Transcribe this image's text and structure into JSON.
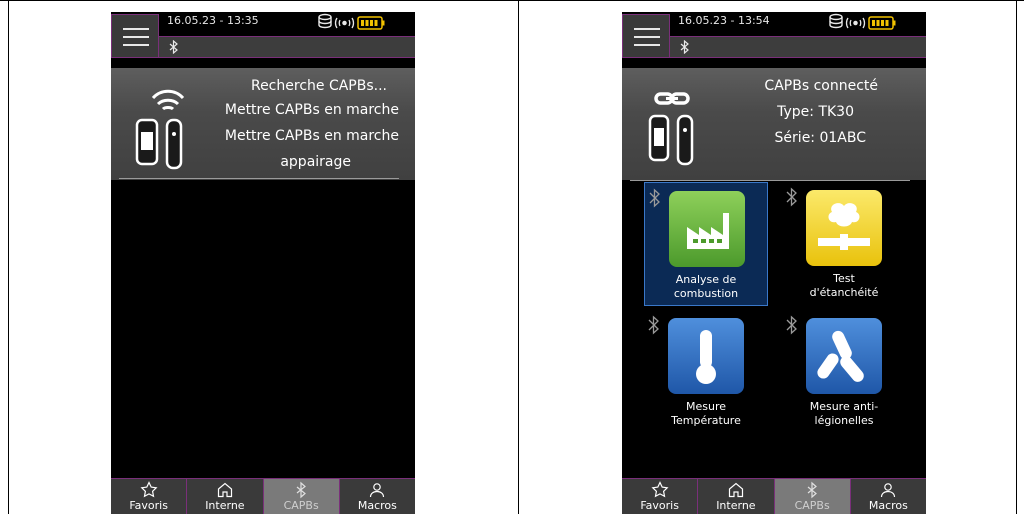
{
  "left_screen": {
    "datetime": "16.05.23 - 13:35",
    "info_lines": [
      "Recherche CAPBs...",
      "Mettre CAPBs en marche",
      "Mettre CAPBs en marche",
      "appairage"
    ]
  },
  "right_screen": {
    "datetime": "16.05.23 - 13:54",
    "info_lines": [
      "CAPBs connecté",
      "Type: TK30",
      "Série: 01ABC"
    ],
    "tiles": [
      {
        "line1": "Analyse de",
        "line2": "combustion"
      },
      {
        "line1": "Test",
        "line2": "d'étanchéité"
      },
      {
        "line1": "Mesure",
        "line2": "Température"
      },
      {
        "line1": "Mesure anti-",
        "line2": "légionelles"
      }
    ]
  },
  "nav": {
    "items": [
      "Favoris",
      "Interne",
      "CAPBs",
      "Macros"
    ],
    "active": "CAPBs"
  },
  "colors": {
    "accent_border": "#7a2f7a",
    "tile_green": "#5aa83a",
    "tile_yellow": "#f3d21a",
    "tile_blue": "#2f6fc0",
    "selected_tile": "#0b2a55"
  }
}
